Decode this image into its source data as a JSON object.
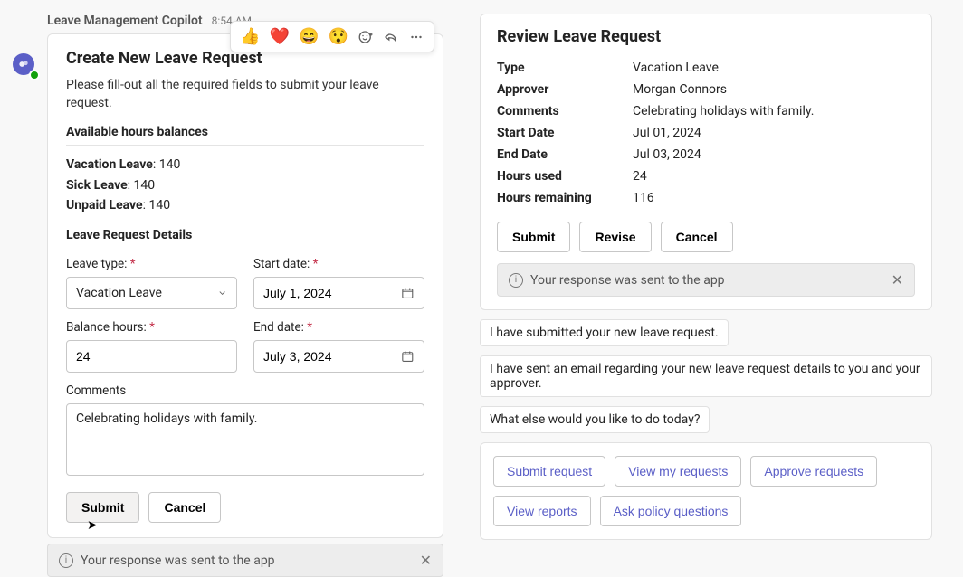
{
  "left": {
    "sender": "Leave Management Copilot",
    "timestamp": "8:54 AM",
    "reactions": {
      "thumbs": "👍",
      "heart": "❤️",
      "laugh": "😄",
      "wow": "😯"
    },
    "card": {
      "title": "Create New Leave Request",
      "intro": "Please fill-out all the required fields to submit your leave request.",
      "balances_heading": "Available hours balances",
      "balances": {
        "vacation_label": "Vacation Leave",
        "vacation_value": "140",
        "sick_label": "Sick Leave",
        "sick_value": "140",
        "unpaid_label": "Unpaid Leave",
        "unpaid_value": "140"
      },
      "details_heading": "Leave Request Details",
      "leave_type_label": "Leave type: ",
      "leave_type_value": "Vacation Leave",
      "balance_hours_label": "Balance hours: ",
      "balance_hours_value": "24",
      "start_date_label": "Start date: ",
      "start_date_value": "July 1, 2024",
      "end_date_label": "End date: ",
      "end_date_value": "July 3, 2024",
      "comments_label": "Comments",
      "comments_value": "Celebrating holidays with family.",
      "submit": "Submit",
      "cancel": "Cancel"
    },
    "status": "Your response was sent to the app"
  },
  "right": {
    "review": {
      "title": "Review Leave Request",
      "rows": [
        {
          "k": "Type",
          "v": "Vacation Leave"
        },
        {
          "k": "Approver",
          "v": "Morgan Connors"
        },
        {
          "k": "Comments",
          "v": "Celebrating holidays with family."
        },
        {
          "k": "Start Date",
          "v": "Jul 01, 2024"
        },
        {
          "k": "End Date",
          "v": "Jul 03, 2024"
        },
        {
          "k": "Hours used",
          "v": "24"
        },
        {
          "k": "Hours remaining",
          "v": "116"
        }
      ],
      "submit": "Submit",
      "revise": "Revise",
      "cancel": "Cancel",
      "status": "Your response was sent to the app"
    },
    "messages": {
      "m1": "I have submitted your new leave request.",
      "m2": "I have sent an email regarding your new leave request details to you and your approver.",
      "m3": "What else would you like to do today?"
    },
    "suggestions": {
      "s1": "Submit request",
      "s2": "View my requests",
      "s3": "Approve requests",
      "s4": "View reports",
      "s5": "Ask policy questions"
    }
  }
}
